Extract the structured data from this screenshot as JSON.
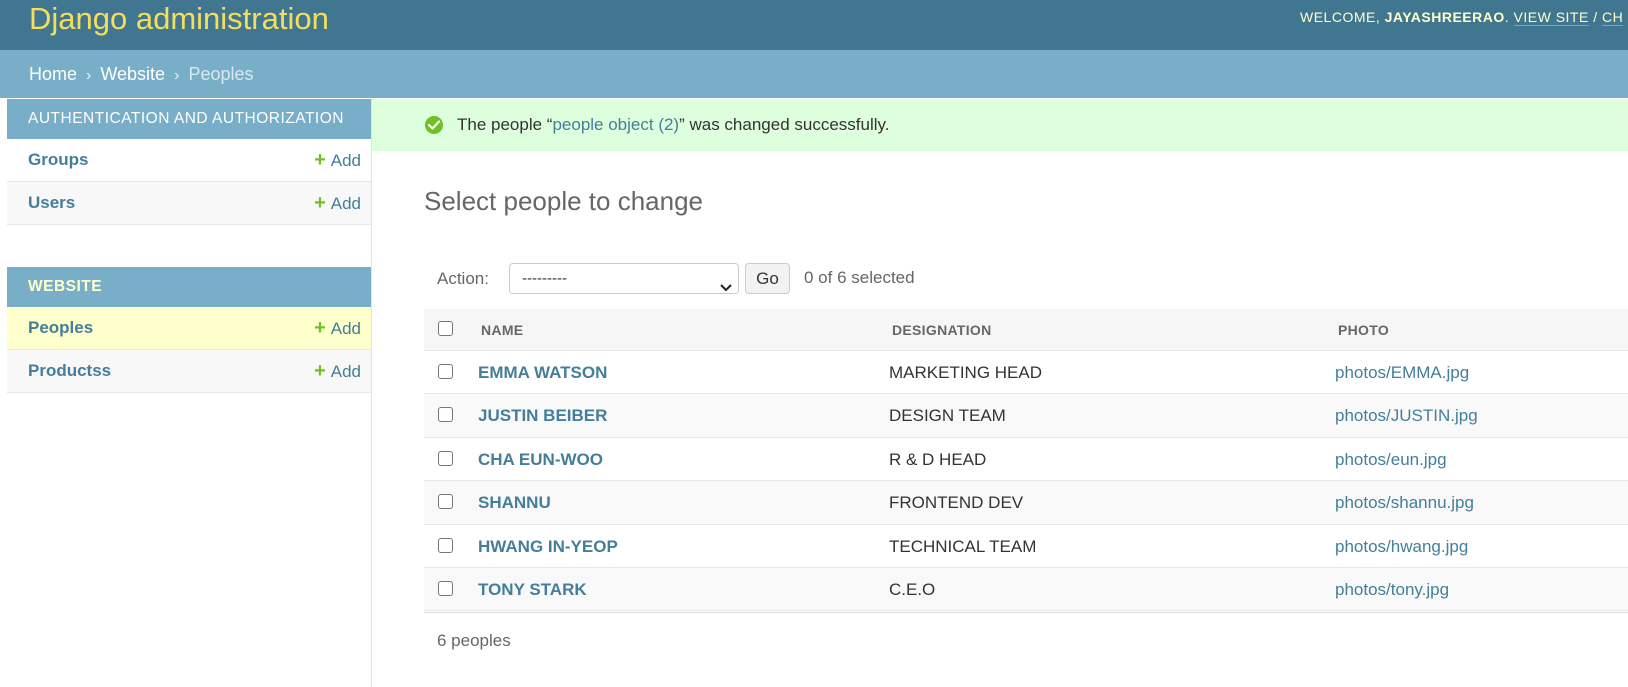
{
  "header": {
    "site_name": "Django administration",
    "welcome": "WELCOME,",
    "username": "JAYASHREERAO",
    "username_suffix": ".",
    "view_site": "VIEW SITE",
    "separator": "/",
    "change_password_partial": "CH"
  },
  "breadcrumbs": {
    "home": "Home",
    "sep": "›",
    "app": "Website",
    "current": "Peoples"
  },
  "sidebar": {
    "modules": [
      {
        "caption": "AUTHENTICATION AND AUTHORIZATION",
        "items": [
          {
            "label": "Groups",
            "add_label": "Add"
          },
          {
            "label": "Users",
            "add_label": "Add"
          }
        ]
      },
      {
        "caption": "WEBSITE",
        "items": [
          {
            "label": "Peoples",
            "add_label": "Add"
          },
          {
            "label": "Productss",
            "add_label": "Add"
          }
        ]
      }
    ]
  },
  "message": {
    "prefix": "The people “",
    "link": "people object (2)",
    "suffix": "” was changed successfully."
  },
  "content": {
    "title": "Select people to change",
    "actions": {
      "label": "Action:",
      "selected_value": "---------",
      "go_label": "Go",
      "counter": "0 of 6 selected"
    },
    "table": {
      "columns": [
        "NAME",
        "DESIGNATION",
        "PHOTO"
      ],
      "rows": [
        {
          "name": "EMMA WATSON",
          "designation": "MARKETING HEAD",
          "photo": "photos/EMMA.jpg"
        },
        {
          "name": "JUSTIN BEIBER",
          "designation": "DESIGN TEAM",
          "photo": "photos/JUSTIN.jpg"
        },
        {
          "name": "CHA EUN-WOO",
          "designation": "R & D HEAD",
          "photo": "photos/eun.jpg"
        },
        {
          "name": "SHANNU",
          "designation": "FRONTEND DEV",
          "photo": "photos/shannu.jpg"
        },
        {
          "name": "HWANG IN-YEOP",
          "designation": "TECHNICAL TEAM",
          "photo": "photos/hwang.jpg"
        },
        {
          "name": "TONY STARK",
          "designation": "C.E.O",
          "photo": "photos/tony.jpg"
        }
      ]
    },
    "paginator": "6 peoples"
  },
  "colors": {
    "header_bg": "#417690",
    "breadcrumb_bg": "#79aec8",
    "brand_yellow": "#f5dd5d",
    "link": "#447e9b",
    "success_bg": "#ddffdd",
    "success_icon": "#70bf2b",
    "current_row_bg": "#ffffcc"
  },
  "icons": {
    "add": "plus-icon",
    "success": "check-circle-icon",
    "select_arrow": "chevron-down-icon"
  }
}
